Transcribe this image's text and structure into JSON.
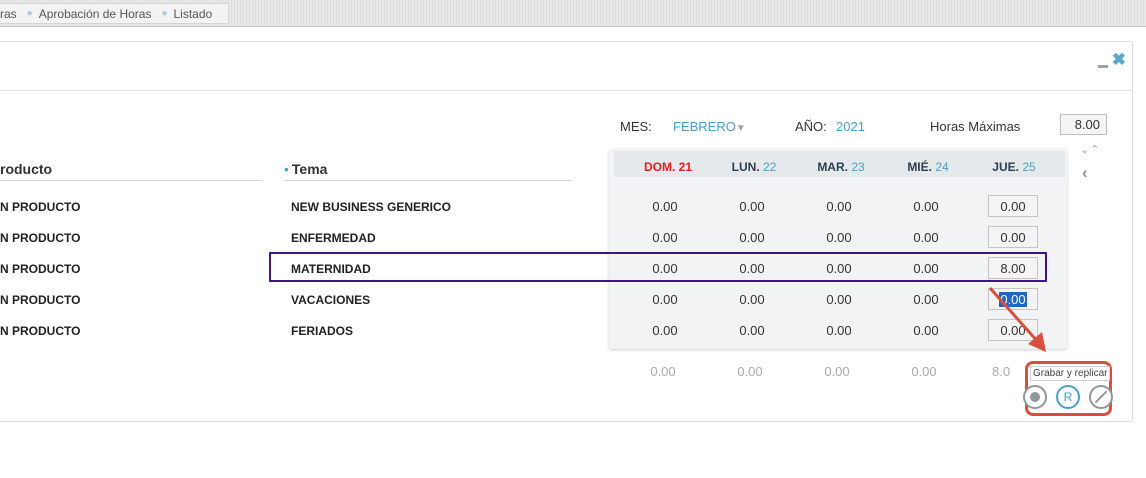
{
  "breadcrumb": {
    "items": [
      "ras",
      "Aprobación de Horas",
      "Listado"
    ]
  },
  "header": {
    "mes_label": "MES:",
    "mes_value": "FEBRERO",
    "anio_label": "AÑO:",
    "anio_value": "2021",
    "horas_max_label": "Horas Máximas",
    "horas_max_value": "8.00"
  },
  "columns": {
    "producto": "roducto",
    "tema": "Tema"
  },
  "days": [
    {
      "name": "DOM.",
      "num": "21"
    },
    {
      "name": "LUN.",
      "num": "22"
    },
    {
      "name": "MAR.",
      "num": "23"
    },
    {
      "name": "MIÉ.",
      "num": "24"
    },
    {
      "name": "JUE.",
      "num": "25"
    }
  ],
  "rows": [
    {
      "producto": "N PRODUCTO",
      "tema": "NEW BUSINESS GENERICO",
      "values": [
        "0.00",
        "0.00",
        "0.00",
        "0.00"
      ],
      "input": "0.00"
    },
    {
      "producto": "N PRODUCTO",
      "tema": "ENFERMEDAD",
      "values": [
        "0.00",
        "0.00",
        "0.00",
        "0.00"
      ],
      "input": "0.00"
    },
    {
      "producto": "N PRODUCTO",
      "tema": "MATERNIDAD",
      "values": [
        "0.00",
        "0.00",
        "0.00",
        "0.00"
      ],
      "input": "8.00"
    },
    {
      "producto": "N PRODUCTO",
      "tema": "VACACIONES",
      "values": [
        "0.00",
        "0.00",
        "0.00",
        "0.00"
      ],
      "input": "0.00"
    },
    {
      "producto": "N PRODUCTO",
      "tema": "FERIADOS",
      "values": [
        "0.00",
        "0.00",
        "0.00",
        "0.00"
      ],
      "input": "0.00"
    }
  ],
  "totals": [
    "0.00",
    "0.00",
    "0.00",
    "0.00",
    "8.0"
  ],
  "actions": {
    "tooltip": "Grabar y replicar",
    "replicate_label": "R"
  },
  "colors": {
    "accent": "#4a9fc6",
    "sunday": "#e51d1d",
    "highlight_row": "#3d1686",
    "highlight_buttons": "#d94f3d"
  }
}
